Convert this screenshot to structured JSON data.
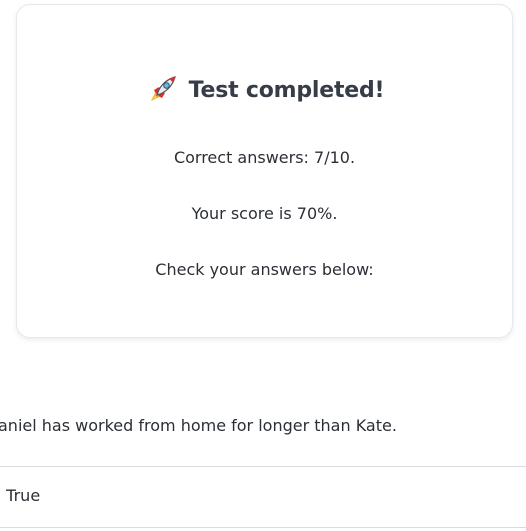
{
  "result": {
    "icon": "rocket-icon",
    "title": "Test completed!",
    "correct_answers": "Correct answers: 7/10.",
    "score": "Your score is 70%.",
    "check": "Check your answers below:"
  },
  "review": {
    "question": "aniel has worked from home for longer than Kate.",
    "answer": ". True"
  }
}
